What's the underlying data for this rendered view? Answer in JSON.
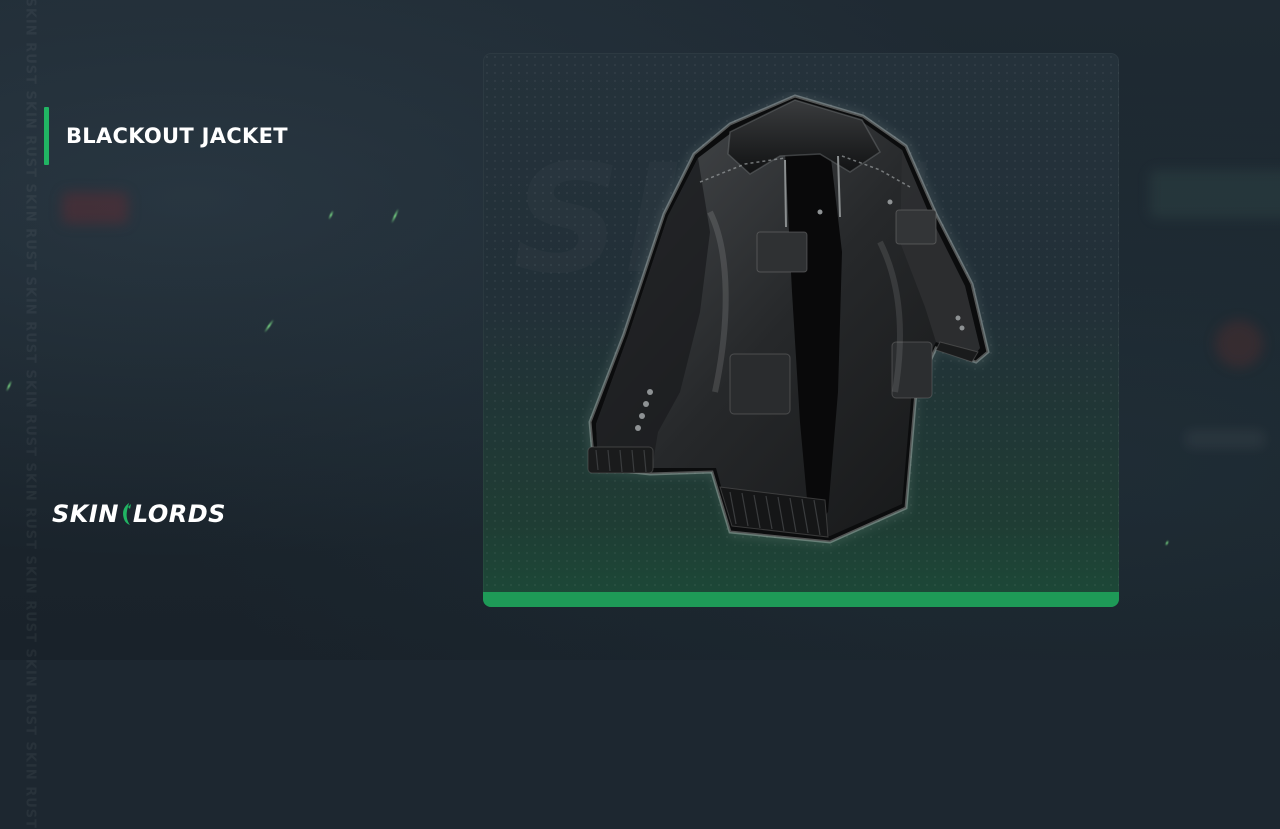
{
  "item": {
    "name": "BLACKOUT JACKET"
  },
  "brand": {
    "logo_text_left": "SKIN",
    "logo_text_right": "LORDS"
  },
  "watermark": {
    "side_text": "SKIN RUST SKIN RUST SKIN RUST SKIN RUST SKIN RUST SKIN RUST SKIN RUST SKIN RUST SKIN RUST"
  },
  "colors": {
    "accent_green": "#21b463",
    "card_bottom_bar": "#1e9a57",
    "background": "#1d2730",
    "title_text": "#ffffff"
  },
  "icons": {
    "product": "jacket-icon",
    "brand_mark": "skinlords-logo-mark"
  }
}
